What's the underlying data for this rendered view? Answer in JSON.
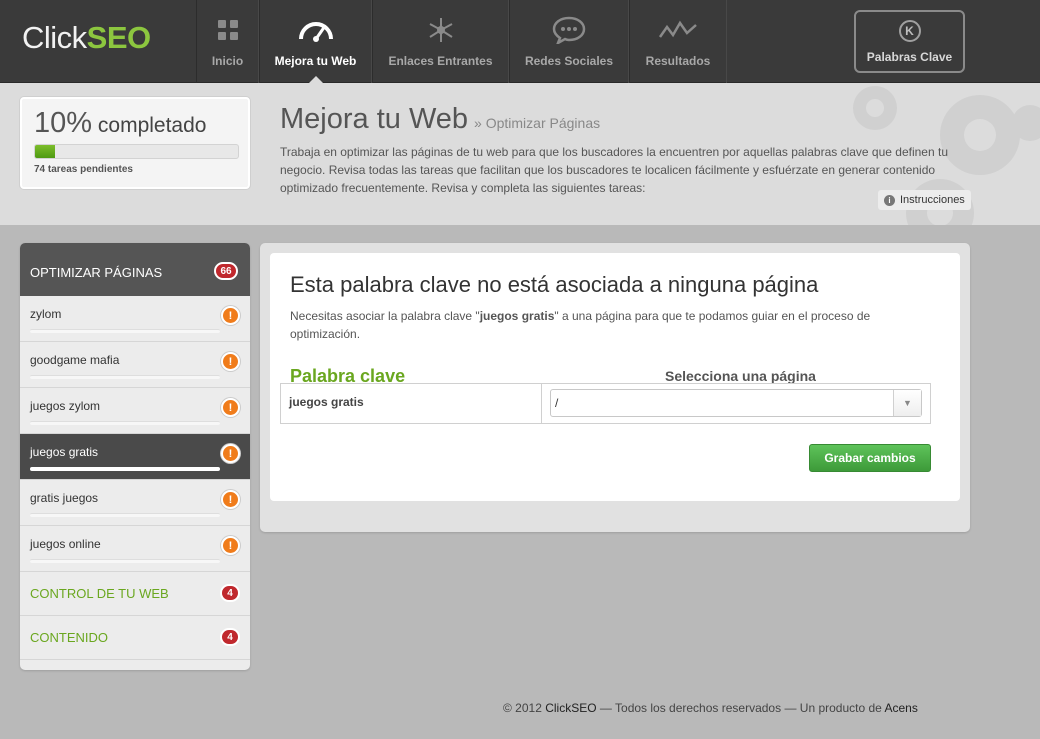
{
  "brand": {
    "part1": "Click",
    "part2": "SEO"
  },
  "nav": [
    {
      "label": "Inicio",
      "icon": "grid-icon"
    },
    {
      "label": "Mejora tu Web",
      "icon": "gauge-icon",
      "active": true
    },
    {
      "label": "Enlaces Entrantes",
      "icon": "network-icon"
    },
    {
      "label": "Redes Sociales",
      "icon": "chat-bubble-icon"
    },
    {
      "label": "Resultados",
      "icon": "line-chart-icon"
    }
  ],
  "keywords_button": {
    "label": "Palabras Clave",
    "icon_letter": "K"
  },
  "progress": {
    "percent_text": "10%",
    "suffix": "completado",
    "value": 0.1,
    "pending": "74 tareas pendientes"
  },
  "page": {
    "title": "Mejora tu Web",
    "breadcrumb": "» Optimizar Páginas",
    "intro": "Trabaja en optimizar las páginas de tu web para que los buscadores la encuentren por aquellas palabras clave que definen tu negocio. Revisa todas las tareas que facilitan que los buscadores te localicen fácilmente y esfuérzate en generar contenido optimizado frecuentemente. Revisa y completa las siguientes tareas:",
    "instructions": "Instrucciones"
  },
  "sidebar": {
    "header": {
      "label": "OPTIMIZAR PÁGINAS",
      "count": "66"
    },
    "items": [
      {
        "label": "zylom",
        "alert": "!"
      },
      {
        "label": "goodgame mafia",
        "alert": "!"
      },
      {
        "label": "juegos zylom",
        "alert": "!"
      },
      {
        "label": "juegos gratis",
        "alert": "!",
        "active": true
      },
      {
        "label": "gratis juegos",
        "alert": "!"
      },
      {
        "label": "juegos online",
        "alert": "!"
      }
    ],
    "sections": [
      {
        "label": "CONTROL DE TU WEB",
        "count": "4"
      },
      {
        "label": "CONTENIDO",
        "count": "4"
      }
    ]
  },
  "main": {
    "heading": "Esta palabra clave no está asociada a ninguna página",
    "desc_pre": "Necesitas asociar la palabra clave \"",
    "desc_kw": "juegos gratis",
    "desc_post": "\" a una página para que te podamos guiar en el proceso de optimización.",
    "col_keyword": "Palabra clave",
    "col_page": "Selecciona una página",
    "row_keyword": "juegos gratis",
    "select_value": "/",
    "save_label": "Grabar cambios"
  },
  "footer": {
    "pre": "© 2012 ",
    "brand": "ClickSEO",
    "mid": " — Todos los derechos reservados — Un producto de ",
    "company": "Acens"
  },
  "colors": {
    "brand_green": "#8cc63f",
    "accent_green": "#6aa71f",
    "alert_orange": "#f07c1b",
    "badge_red": "#c0282d"
  }
}
